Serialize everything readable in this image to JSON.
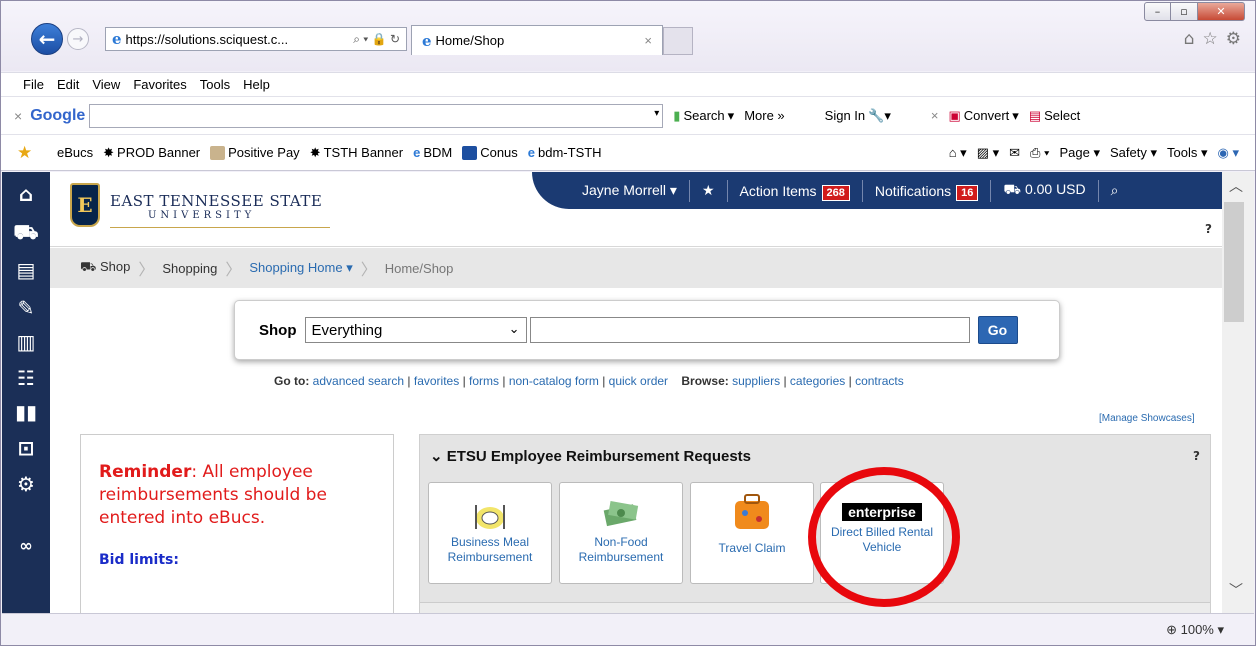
{
  "browser": {
    "address_url": "https://solutions.sciquest.c...",
    "tab_title": "Home/Shop",
    "menu": [
      "File",
      "Edit",
      "View",
      "Favorites",
      "Tools",
      "Help"
    ],
    "google": {
      "logo": "Google",
      "search": "Search",
      "more": "More »",
      "sign_in": "Sign In",
      "convert": "Convert",
      "select": "Select"
    },
    "favorites": [
      "eBucs",
      "PROD Banner",
      "Positive Pay",
      "TSTH Banner",
      "BDM",
      "Conus",
      "bdm-TSTH"
    ],
    "cmd": [
      "Page",
      "Safety",
      "Tools"
    ],
    "zoom": "100%"
  },
  "header": {
    "university": "EAST TENNESSEE STATE",
    "university_sub": "UNIVERSITY",
    "user": "Jayne Morrell",
    "action_items_label": "Action Items",
    "action_items_count": "268",
    "notifications_label": "Notifications",
    "notifications_count": "16",
    "cart_total": "0.00 USD",
    "help": "?"
  },
  "breadcrumb": {
    "shop": "Shop",
    "shopping": "Shopping",
    "shopping_home": "Shopping Home",
    "current": "Home/Shop"
  },
  "shop": {
    "label": "Shop",
    "scope": "Everything",
    "go": "Go"
  },
  "goto": {
    "label": "Go to:",
    "links": [
      "advanced search",
      "favorites",
      "forms",
      "non-catalog form",
      "quick order"
    ],
    "browse_label": "Browse:",
    "browse_links": [
      "suppliers",
      "categories",
      "contracts"
    ]
  },
  "manage_showcases": "[Manage Showcases]",
  "reminder": {
    "label": "Reminder",
    "text": ": All employee reimbursements should be entered into eBucs.",
    "bid_limits": "Bid limits:"
  },
  "panel": {
    "title": "ETSU Employee Reimbursement Requests",
    "help": "?",
    "tiles": [
      {
        "label": "Business Meal Reimbursement"
      },
      {
        "label": "Non-Food Reimbursement"
      },
      {
        "label": "Travel Claim"
      },
      {
        "label": "Direct Billed Rental Vehicle",
        "logo": "enterprise"
      }
    ]
  }
}
